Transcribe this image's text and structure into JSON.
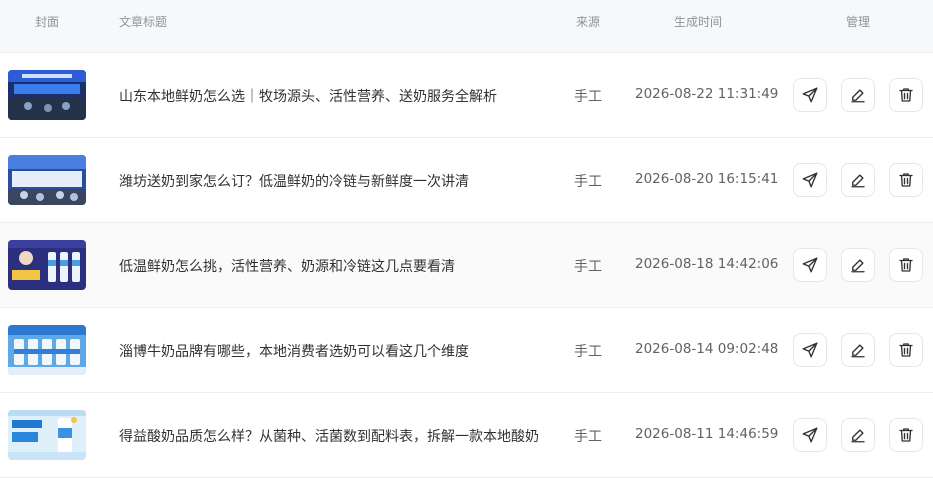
{
  "table": {
    "headers": {
      "cover": "封面",
      "title": "文章标题",
      "source": "来源",
      "time": "生成时间",
      "manage": "管理"
    },
    "rows": [
      {
        "title": "山东本地鲜奶怎么选｜牧场源头、活性营养、送奶服务全解析",
        "source": "手工",
        "time": "2026-08-22 11:31:49"
      },
      {
        "title": "潍坊送奶到家怎么订？低温鲜奶的冷链与新鲜度一次讲清",
        "source": "手工",
        "time": "2026-08-20 16:15:41"
      },
      {
        "title": "低温鲜奶怎么挑，活性营养、奶源和冷链这几点要看清",
        "source": "手工",
        "time": "2026-08-18 14:42:06"
      },
      {
        "title": "淄博牛奶品牌有哪些，本地消费者选奶可以看这几个维度",
        "source": "手工",
        "time": "2026-08-14 09:02:48"
      },
      {
        "title": "得益酸奶品质怎么样？从菌种、活菌数到配料表，拆解一款本地酸奶",
        "source": "手工",
        "time": "2026-08-11 14:46:59"
      }
    ]
  },
  "icons": {
    "send": "send-icon",
    "edit": "edit-icon",
    "delete": "trash-icon"
  }
}
